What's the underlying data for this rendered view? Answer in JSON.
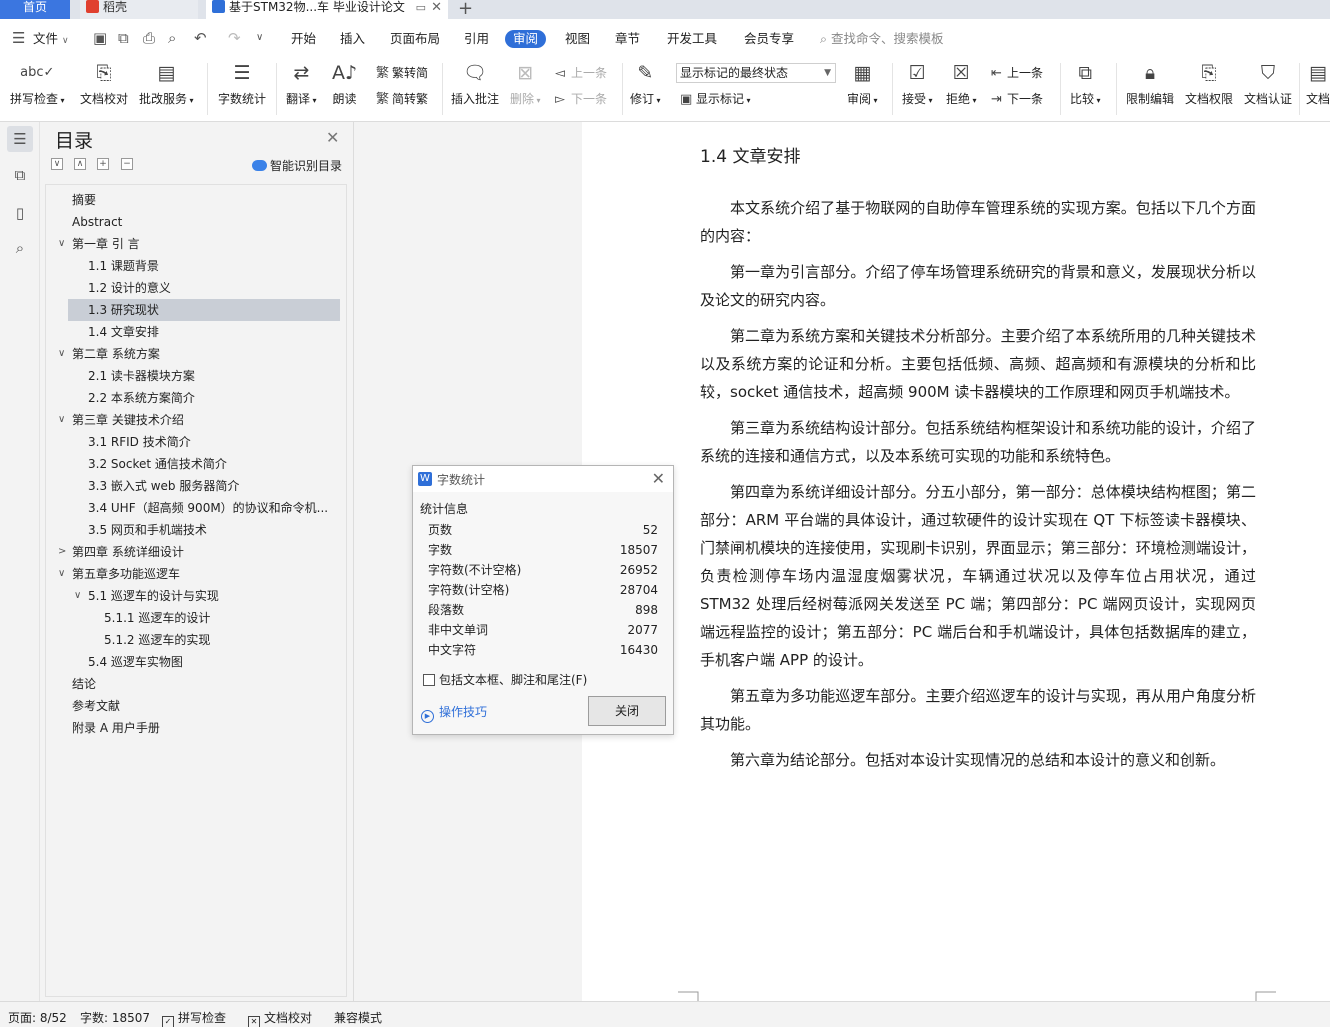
{
  "tabs": {
    "home": "首页",
    "daoke": "稻壳",
    "doc": "基于STM32物...车 毕业设计论文"
  },
  "menu": {
    "file": "文件",
    "items": [
      "开始",
      "插入",
      "页面布局",
      "引用",
      "审阅",
      "视图",
      "章节",
      "开发工具",
      "会员专享"
    ],
    "search": "查找命令、搜索模板"
  },
  "ribbon": {
    "spell": "拼写检查",
    "proof": "文档校对",
    "annot_service": "批改服务",
    "word_count": "字数统计",
    "translate": "翻译",
    "read": "朗读",
    "trad": "繁转简",
    "simp": "简转繁",
    "insert_comment": "插入批注",
    "delete": "删除",
    "prev_comment": "上一条",
    "next_comment": "下一条",
    "revise": "修订",
    "markup_state": "显示标记的最终状态",
    "show_markup": "显示标记",
    "review": "审阅",
    "accept": "接受",
    "reject": "拒绝",
    "prev": "上一条",
    "next": "下一条",
    "compare": "比较",
    "restrict": "限制编辑",
    "rights": "文档权限",
    "certify": "文档认证",
    "more": "文档"
  },
  "toc": {
    "title": "目录",
    "smart": "智能识别目录",
    "items": [
      {
        "label": "摘要",
        "level": 0,
        "toggle": ""
      },
      {
        "label": "Abstract",
        "level": 0,
        "toggle": ""
      },
      {
        "label": "第一章 引 言",
        "level": 0,
        "toggle": "v"
      },
      {
        "label": "1.1 课题背景",
        "level": 1,
        "toggle": ""
      },
      {
        "label": "1.2 设计的意义",
        "level": 1,
        "toggle": ""
      },
      {
        "label": "1.3 研究现状",
        "level": 1,
        "toggle": "",
        "selected": true
      },
      {
        "label": "1.4 文章安排",
        "level": 1,
        "toggle": ""
      },
      {
        "label": "第二章  系统方案",
        "level": 0,
        "toggle": "v"
      },
      {
        "label": "2.1  读卡器模块方案",
        "level": 1,
        "toggle": ""
      },
      {
        "label": "2.2  本系统方案简介",
        "level": 1,
        "toggle": ""
      },
      {
        "label": "第三章  关键技术介绍",
        "level": 0,
        "toggle": "v"
      },
      {
        "label": "3.1 RFID 技术简介",
        "level": 1,
        "toggle": ""
      },
      {
        "label": "3.2 Socket 通信技术简介",
        "level": 1,
        "toggle": ""
      },
      {
        "label": "3.3  嵌入式 web 服务器简介",
        "level": 1,
        "toggle": ""
      },
      {
        "label": "3.4 UHF（超高频 900M）的协议和命令机...",
        "level": 1,
        "toggle": ""
      },
      {
        "label": "3.5  网页和手机端技术",
        "level": 1,
        "toggle": ""
      },
      {
        "label": "第四章  系统详细设计",
        "level": 0,
        "toggle": ">"
      },
      {
        "label": "第五章多功能巡逻车",
        "level": 0,
        "toggle": "v"
      },
      {
        "label": "5.1  巡逻车的设计与实现",
        "level": 1,
        "toggle": "v"
      },
      {
        "label": "5.1.1  巡逻车的设计",
        "level": 2,
        "toggle": ""
      },
      {
        "label": "5.1.2  巡逻车的实现",
        "level": 2,
        "toggle": ""
      },
      {
        "label": "5.4  巡逻车实物图",
        "level": 1,
        "toggle": ""
      },
      {
        "label": "结论",
        "level": 0,
        "toggle": ""
      },
      {
        "label": "参考文献",
        "level": 0,
        "toggle": ""
      },
      {
        "label": "附录 A  用户手册",
        "level": 0,
        "toggle": ""
      }
    ]
  },
  "doc": {
    "heading": "1.4 文章安排",
    "paragraphs": [
      "本文系统介绍了基于物联网的自助停车管理系统的实现方案。包括以下几个方面的内容：",
      "第一章为引言部分。介绍了停车场管理系统研究的背景和意义，发展现状分析以及论文的研究内容。",
      "第二章为系统方案和关键技术分析部分。主要介绍了本系统所用的几种关键技术以及系统方案的论证和分析。主要包括低频、高频、超高频和有源模块的分析和比较，socket 通信技术，超高频 900M 读卡器模块的工作原理和网页手机端技术。",
      "第三章为系统结构设计部分。包括系统结构框架设计和系统功能的设计，介绍了系统的连接和通信方式，以及本系统可实现的功能和系统特色。",
      "第四章为系统详细设计部分。分五小部分，第一部分：总体模块结构框图；第二部分：ARM 平台端的具体设计，通过软硬件的设计实现在 QT 下标签读卡器模块、门禁闸机模块的连接使用，实现刷卡识别，界面显示；第三部分：环境检测端设计，负责检测停车场内温湿度烟雾状况，车辆通过状况以及停车位占用状况，通过 STM32 处理后经树莓派网关发送至 PC 端；第四部分：PC 端网页设计，实现网页端远程监控的设计；第五部分：PC 端后台和手机端设计，具体包括数据库的建立，手机客户端 APP 的设计。",
      "第五章为多功能巡逻车部分。主要介绍巡逻车的设计与实现，再从用户角度分析其功能。",
      "第六章为结论部分。包括对本设计实现情况的总结和本设计的意义和创新。"
    ]
  },
  "dialog": {
    "title": "字数统计",
    "section": "统计信息",
    "stats": [
      {
        "label": "页数",
        "value": "52"
      },
      {
        "label": "字数",
        "value": "18507"
      },
      {
        "label": "字符数(不计空格)",
        "value": "26952"
      },
      {
        "label": "字符数(计空格)",
        "value": "28704"
      },
      {
        "label": "段落数",
        "value": "898"
      },
      {
        "label": "非中文单词",
        "value": "2077"
      },
      {
        "label": "中文字符",
        "value": "16430"
      }
    ],
    "include": "包括文本框、脚注和尾注(F)",
    "tips": "操作技巧",
    "close": "关闭"
  },
  "status": {
    "page": "页面: 8/52",
    "words": "字数: 18507",
    "spell": "拼写检查",
    "proof": "文档校对",
    "compat": "兼容模式"
  },
  "colors": {
    "accent": "#2f6fd8",
    "home_tab": "#3b76e0",
    "daoke_icon": "#e0402f"
  }
}
